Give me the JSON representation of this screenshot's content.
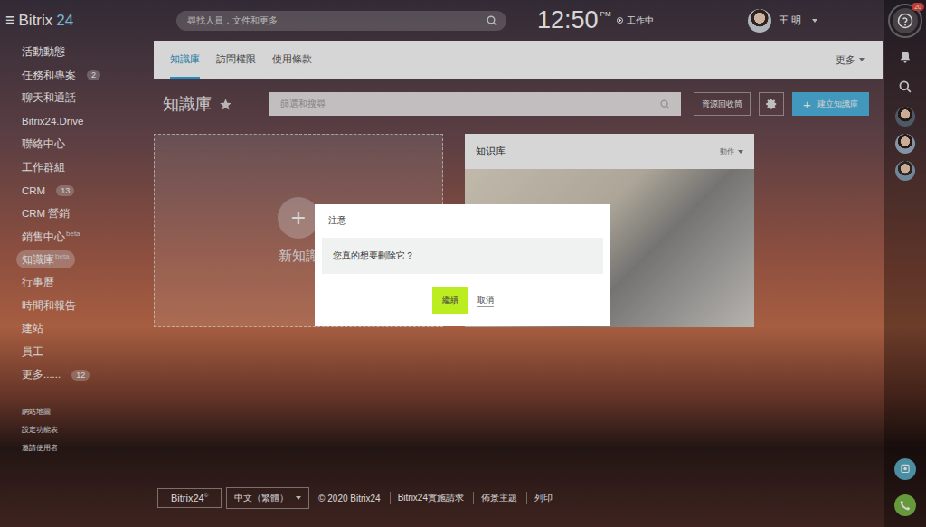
{
  "app": {
    "menu_icon": "≡",
    "logo_name": "Bitrix",
    "logo_number": "24"
  },
  "header": {
    "search_placeholder": "尋找人員，文件和更多",
    "clock": "12:50",
    "clock_period": "PM",
    "work_status": "工作中",
    "user_name": "王 明"
  },
  "sidebar": {
    "items": [
      {
        "label": "活動動態",
        "badge": "",
        "tag": "",
        "selected": false
      },
      {
        "label": "任務和專案",
        "badge": "2",
        "tag": "",
        "selected": false
      },
      {
        "label": "聊天和通話",
        "badge": "",
        "tag": "",
        "selected": false
      },
      {
        "label": "Bitrix24.Drive",
        "badge": "",
        "tag": "",
        "selected": false
      },
      {
        "label": "聯絡中心",
        "badge": "",
        "tag": "",
        "selected": false
      },
      {
        "label": "工作群組",
        "badge": "",
        "tag": "",
        "selected": false
      },
      {
        "label": "CRM",
        "badge": "13",
        "tag": "",
        "selected": false
      },
      {
        "label": "CRM 營銷",
        "badge": "",
        "tag": "",
        "selected": false
      },
      {
        "label": "銷售中心",
        "badge": "",
        "tag": "beta",
        "selected": false
      },
      {
        "label": "知識庫",
        "badge": "",
        "tag": "beta",
        "selected": true
      },
      {
        "label": "行事曆",
        "badge": "",
        "tag": "",
        "selected": false
      },
      {
        "label": "時間和報告",
        "badge": "",
        "tag": "",
        "selected": false
      },
      {
        "label": "建站",
        "badge": "",
        "tag": "",
        "selected": false
      },
      {
        "label": "員工",
        "badge": "",
        "tag": "",
        "selected": false
      },
      {
        "label": "更多......",
        "badge": "12",
        "tag": "",
        "selected": false
      }
    ],
    "links": [
      "網站地圖",
      "設定功能表",
      "邀請使用者"
    ]
  },
  "tabs": [
    {
      "label": "知識庫",
      "selected": true
    },
    {
      "label": "訪問權限",
      "selected": false
    },
    {
      "label": "使用條款",
      "selected": false
    }
  ],
  "tabs_more": "更多",
  "toolbar": {
    "title": "知識庫",
    "filter_placeholder": "篩選和搜尋",
    "recycle_button": "資源回收筒",
    "create_icon": "+",
    "create_button": "建立知識庫"
  },
  "cards": [
    {
      "kind": "new",
      "icon": "+",
      "title": "新知識"
    },
    {
      "kind": "site",
      "title": "知识库",
      "menu": "動作"
    }
  ],
  "footer": {
    "logo": "Bitrix24",
    "logo_mark": "©",
    "language": "中文（繁體）",
    "links": [
      "© 2020 Bitrix24",
      "Bitrix24實施請求",
      "佈景主題",
      "列印"
    ]
  },
  "right_bar": {
    "help_badge": "20"
  },
  "dialog": {
    "title": "注意",
    "message": "您真的想要刪除它？",
    "buttons": [
      {
        "label": "繼續",
        "primary": true
      },
      {
        "label": "取消",
        "primary": false
      }
    ]
  }
}
